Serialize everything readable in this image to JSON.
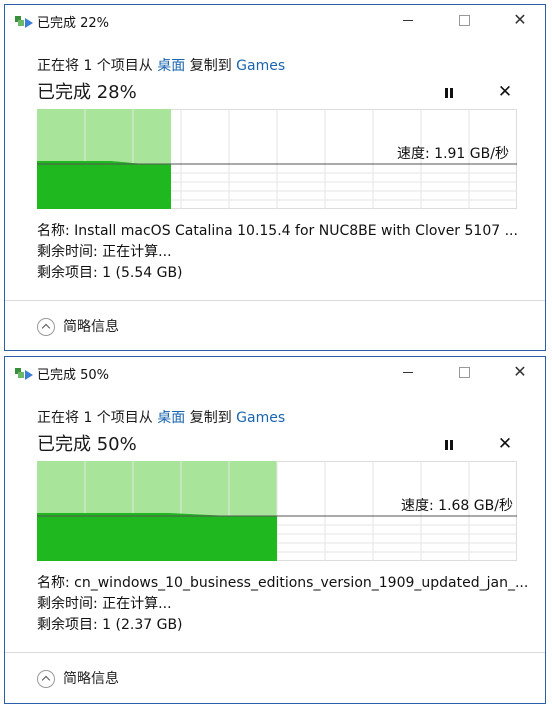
{
  "colors": {
    "border": "#2b5fa8",
    "link": "#1a64b0",
    "progress_light": "#a8e59a",
    "progress_dark": "#1fb81f",
    "grid": "#dcdcdc"
  },
  "windows": [
    {
      "title": "已完成 22%",
      "copy_line": {
        "prefix": "正在将 1 个项目从 ",
        "from": "桌面",
        "middle": " 复制到 ",
        "to": "Games"
      },
      "percent_text": "已完成 28%",
      "progress": 0.28,
      "speed_label": "速度: 1.91 GB/秒",
      "speed_level": 0.45,
      "name_row": "名称: Install macOS Catalina 10.15.4 for NUC8BE with Clover 5107 ...",
      "time_row": "剩余时间: 正在计算...",
      "items_row": "剩余项目: 1 (5.54 GB)",
      "footer_label": "简略信息"
    },
    {
      "title": "已完成 50%",
      "copy_line": {
        "prefix": "正在将 1 个项目从 ",
        "from": "桌面",
        "middle": " 复制到 ",
        "to": "Games"
      },
      "percent_text": "已完成 50%",
      "progress": 0.5,
      "speed_label": "速度: 1.68 GB/秒",
      "speed_level": 0.45,
      "name_row": "名称: cn_windows_10_business_editions_version_1909_updated_jan_...",
      "time_row": "剩余时间: 正在计算...",
      "items_row": "剩余项目: 1 (2.37 GB)",
      "footer_label": "简略信息"
    }
  ],
  "icons": {
    "title_icon": "file-copy-icon",
    "minimize": "minimize-icon",
    "maximize": "maximize-icon",
    "close": "close-icon",
    "pause": "pause-icon",
    "cancel": "cancel-icon",
    "collapse": "chevron-up-icon"
  }
}
